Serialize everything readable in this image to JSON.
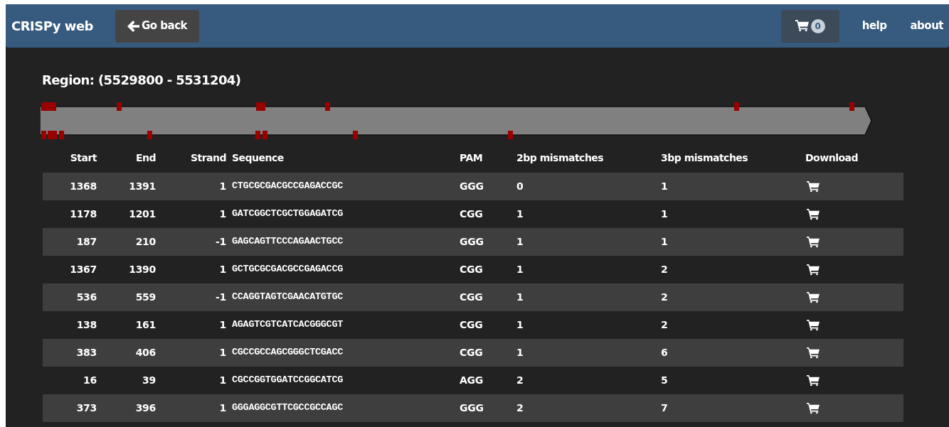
{
  "navbar": {
    "brand": "CRISPy web",
    "back_button": "Go back",
    "cart_count": "0",
    "links": [
      "help",
      "about"
    ]
  },
  "region": {
    "title": "Region: (5529800 - 5531204)"
  },
  "table": {
    "columns": [
      "Start",
      "End",
      "Strand",
      "Sequence",
      "PAM",
      "2bp mismatches",
      "3bp mismatches",
      "Download"
    ],
    "rows": [
      {
        "start": "1368",
        "end": "1391",
        "strand": "1",
        "sequence": "CTGCGCGACGCCGAGACCGC",
        "pam": "GGG",
        "mm2": "0",
        "mm3": "1"
      },
      {
        "start": "1178",
        "end": "1201",
        "strand": "1",
        "sequence": "GATCGGCTCGCTGGAGATCG",
        "pam": "CGG",
        "mm2": "1",
        "mm3": "1"
      },
      {
        "start": "187",
        "end": "210",
        "strand": "-1",
        "sequence": "GAGCAGTTCCCAGAACTGCC",
        "pam": "GGG",
        "mm2": "1",
        "mm3": "1"
      },
      {
        "start": "1367",
        "end": "1390",
        "strand": "1",
        "sequence": "GCTGCGCGACGCCGAGACCG",
        "pam": "CGG",
        "mm2": "1",
        "mm3": "2"
      },
      {
        "start": "536",
        "end": "559",
        "strand": "-1",
        "sequence": "CCAGGTAGTCGAACATGTGC",
        "pam": "CGG",
        "mm2": "1",
        "mm3": "2"
      },
      {
        "start": "138",
        "end": "161",
        "strand": "1",
        "sequence": "AGAGTCGTCATCACGGGCGT",
        "pam": "CGG",
        "mm2": "1",
        "mm3": "2"
      },
      {
        "start": "383",
        "end": "406",
        "strand": "1",
        "sequence": "CGCCGCCAGCGGGCTCGACC",
        "pam": "CGG",
        "mm2": "1",
        "mm3": "6"
      },
      {
        "start": "16",
        "end": "39",
        "strand": "1",
        "sequence": "CGCCGGTGGATCCGGCATCG",
        "pam": "AGG",
        "mm2": "2",
        "mm3": "5"
      },
      {
        "start": "373",
        "end": "396",
        "strand": "1",
        "sequence": "GGGAGGCGTTCGCCGCCAGC",
        "pam": "GGG",
        "mm2": "2",
        "mm3": "7"
      }
    ]
  }
}
